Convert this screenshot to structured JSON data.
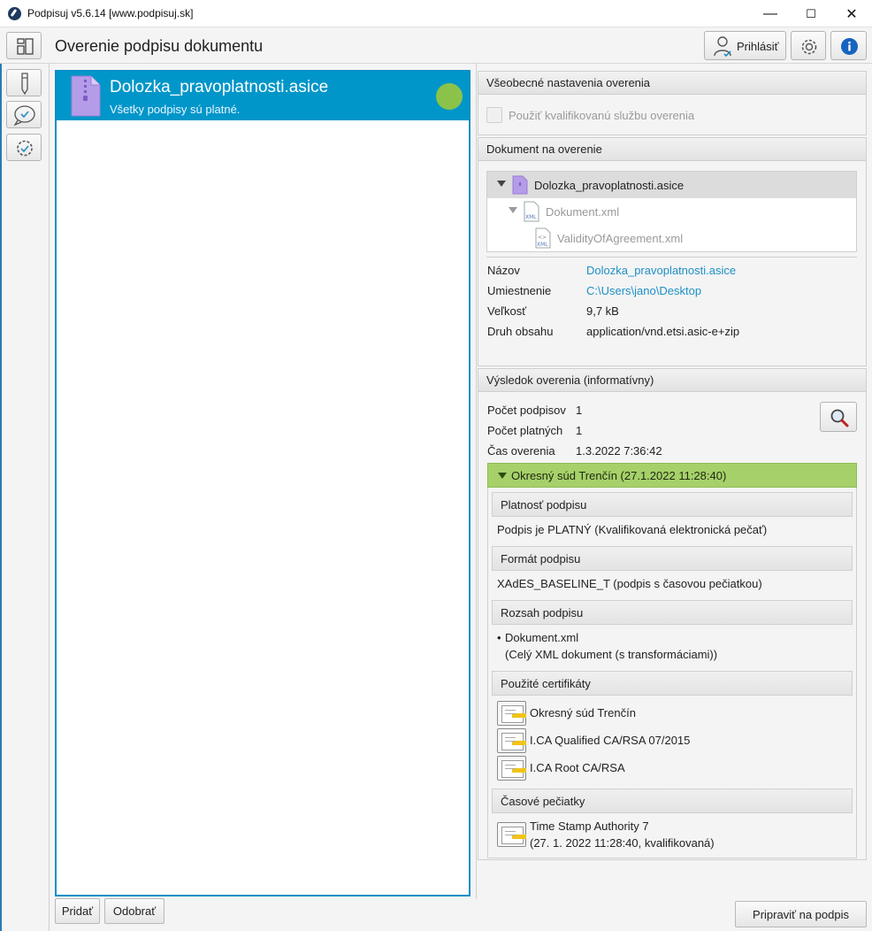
{
  "window": {
    "title": "Podpisuj v5.6.14 [www.podpisuj.sk]",
    "minimize": "—",
    "maximize": "☐",
    "close": "✕"
  },
  "toolbar": {
    "page_title": "Overenie podpisu dokumentu",
    "login_label": "Prihlásiť"
  },
  "file_list": {
    "items": [
      {
        "name": "Dolozka_pravoplatnosti.asice",
        "status": "Všetky podpisy sú platné."
      }
    ],
    "add_label": "Pridať",
    "remove_label": "Odobrať"
  },
  "settings": {
    "header": "Všeobecné nastavenia overenia",
    "qualified_service_label": "Použiť kvalifikovanú službu overenia"
  },
  "document": {
    "header": "Dokument na overenie",
    "tree": [
      {
        "name": "Dolozka_pravoplatnosti.asice"
      },
      {
        "name": "Dokument.xml"
      },
      {
        "name": "ValidityOfAgreement.xml"
      }
    ],
    "props": [
      {
        "label": "Názov",
        "value": "Dolozka_pravoplatnosti.asice"
      },
      {
        "label": "Umiestnenie",
        "value": "C:\\Users\\jano\\Desktop"
      },
      {
        "label": "Veľkosť",
        "value": "9,7 kB"
      },
      {
        "label": "Druh obsahu",
        "value": "application/vnd.etsi.asic-e+zip"
      }
    ]
  },
  "result": {
    "header": "Výsledok overenia (informatívny)",
    "stats": [
      {
        "label": "Počet podpisov",
        "value": "1"
      },
      {
        "label": "Počet platných",
        "value": "1"
      },
      {
        "label": "Čas overenia",
        "value": "1.3.2022 7:36:42"
      }
    ],
    "signature": {
      "title": "Okresný súd Trenčín (27.1.2022 11:28:40)",
      "validity_header": "Platnosť podpisu",
      "validity_value": "Podpis je PLATNÝ (Kvalifikovaná elektronická pečať)",
      "format_header": "Formát podpisu",
      "format_value": "XAdES_BASELINE_T (podpis s časovou pečiatkou)",
      "scope_header": "Rozsah podpisu",
      "scope_item": "Dokument.xml",
      "scope_detail": "(Celý XML dokument (s transformáciami))",
      "certs_header": "Použité certifikáty",
      "certs": [
        "Okresný súd Trenčín",
        "I.CA Qualified CA/RSA 07/2015",
        "I.CA Root CA/RSA"
      ],
      "timestamps_header": "Časové pečiatky",
      "timestamp_name": "Time Stamp Authority 7",
      "timestamp_detail": "(27. 1. 2022 11:28:40, kvalifikovaná)"
    }
  },
  "footer": {
    "prepare_label": "Pripraviť na podpis"
  },
  "colors": {
    "accent": "#0096c9",
    "valid": "#8bc34a",
    "signature_header": "#a6d16a"
  }
}
